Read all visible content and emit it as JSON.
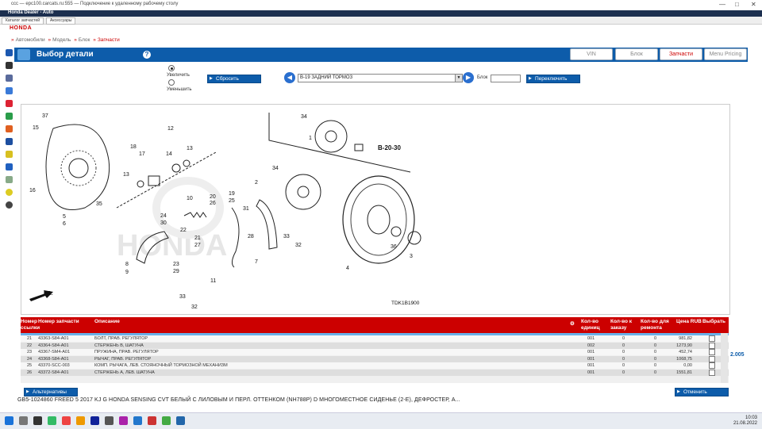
{
  "window": {
    "title": "ccc — epc100.carcats.ru:555 — Подключение к удаленному рабочему столу",
    "controls": [
      "—",
      "□",
      "✕"
    ]
  },
  "app": {
    "title": "Honda Dealer - Auto",
    "tabs": [
      "Каталог запчастей",
      "Аксессуары"
    ],
    "logo": "HONDA"
  },
  "breadcrumb": {
    "items": [
      "Автомобили",
      "Модель",
      "Блок"
    ],
    "current": "Запчасти",
    "separator": "»"
  },
  "header": {
    "title": "Выбор детали",
    "help": "?",
    "nav": [
      "VIN",
      "Блок",
      "Запчасти",
      "Menu Pricing"
    ],
    "active_nav": "Запчасти"
  },
  "controls": {
    "zoom_in": "Увеличить",
    "zoom_out": "Уменьшить",
    "reset": "Сбросить",
    "block_select": "B-19 ЗАДНИЙ ТОРМОЗ",
    "block_label": "Блок",
    "block_input": "",
    "switch": "Переключить",
    "prev": "◀",
    "next": "▶"
  },
  "diagram": {
    "code": "TDK1B1900",
    "ref": "B-20-30",
    "fr_label": "FR.",
    "watermark": "HONDA",
    "callouts": [
      "37",
      "15",
      "12",
      "18",
      "17",
      "14",
      "13",
      "13",
      "16",
      "5",
      "6",
      "35",
      "10",
      "20",
      "26",
      "19",
      "25",
      "24",
      "30",
      "22",
      "21",
      "27",
      "31",
      "28",
      "7",
      "23",
      "29",
      "8",
      "9",
      "33",
      "32",
      "11",
      "34",
      "34",
      "2",
      "1",
      "33",
      "32",
      "4",
      "36",
      "3"
    ]
  },
  "table": {
    "headers": [
      "Номер ссылки",
      "Номер запчасти",
      "Описание",
      "Кол-во единиц",
      "Кол-во к заказу",
      "Кол-во для ремонта",
      "Цена RUB",
      "Выбрать"
    ],
    "rows": [
      {
        "ref": "21",
        "part": "43363-S84-A01",
        "desc": "БОЛТ, ПРАВ. РЕГУЛЯТОР",
        "units": "001",
        "order": "0",
        "repair": "0",
        "price": "981,82"
      },
      {
        "ref": "22",
        "part": "43364-S84-A01",
        "desc": "СТЕРЖЕНЬ В, ШАТУНА",
        "units": "002",
        "order": "0",
        "repair": "0",
        "price": "1273,90"
      },
      {
        "ref": "23",
        "part": "43367-SM4-A01",
        "desc": "ПРУЖИНА, ПРАВ. РЕГУЛЯТОР",
        "units": "001",
        "order": "0",
        "repair": "0",
        "price": "452,74"
      },
      {
        "ref": "24",
        "part": "43368-S84-A01",
        "desc": "РЫЧАГ, ПРАВ. РЕГУЛЯТОР",
        "units": "001",
        "order": "0",
        "repair": "0",
        "price": "1068,75"
      },
      {
        "ref": "25",
        "part": "43370-SCC-003",
        "desc": "КОМП. РЫЧАГА, ЛЕВ. СТОЯНОЧНЫЙ ТОРМОЗНОЙ МЕХАНИЗМ",
        "units": "001",
        "order": "0",
        "repair": "0",
        "price": "0,00"
      },
      {
        "ref": "26",
        "part": "43372-S84-A01",
        "desc": "СТЕРЖЕНЬ А, ЛЕВ. ШАТУНА",
        "units": "001",
        "order": "0",
        "repair": "0",
        "price": "1551,81"
      }
    ]
  },
  "footer": {
    "alternatives": "Альтернативы",
    "apply": "Отменить",
    "side_value": "2.005",
    "vin_line": "GB5-1024860   FREED   5   2017   KJ   G HONDA SENSING   CVT   БЕЛЫЙ С ЛИЛОВЫМ И ПЕРЛ. ОТТЕНКОМ (NH788P)   D   МНОГОМЕСТНОЕ СИДЕНЬЕ (2-Е), ДЕФРОСТЕР, А..."
  },
  "taskbar": {
    "time": "10:03",
    "date": "21.08.2022"
  }
}
